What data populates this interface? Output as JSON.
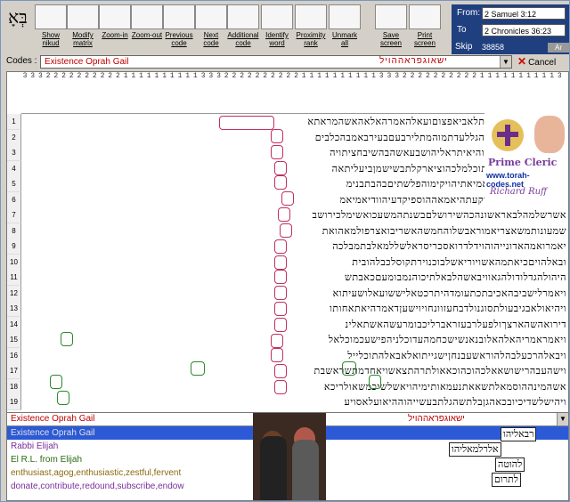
{
  "toolbar": {
    "items": [
      {
        "label": "Show\nnikud",
        "icon": "hebrew-letters-icon"
      },
      {
        "label": "Modify\nmatrix",
        "icon": "grid-icon"
      },
      {
        "label": "Zoom-in",
        "icon": "zoom-in-icon"
      },
      {
        "label": "Zoom-out",
        "icon": "zoom-out-icon"
      },
      {
        "label": "Previous\ncode",
        "icon": "arrow-left-icon"
      },
      {
        "label": "Next\ncode",
        "icon": "arrow-right-icon"
      },
      {
        "label": "Additional\ncode",
        "icon": "circles-icon"
      },
      {
        "label": "Identify\nword",
        "icon": "identify-icon"
      },
      {
        "label": "Proximity\nrank",
        "icon": "proximity-icon"
      },
      {
        "label": "Unmark\nall",
        "icon": "unmark-icon"
      },
      {
        "label": "Save\nscreen",
        "icon": "save-icon"
      },
      {
        "label": "Print\nscreen",
        "icon": "print-icon"
      }
    ],
    "logo_text": "בְּאָ"
  },
  "range": {
    "from_label": "From:",
    "from_value": "2 Samuel 3:12",
    "to_label": "To",
    "to_value": "2 Chronicles 36:23",
    "skip_label": "Skip",
    "skip_value": "38858",
    "ar_label": "Ar"
  },
  "codes": {
    "label": "Codes :",
    "value": "Existence Oprah Gail",
    "hebrew": "ישאוגפראההויל",
    "cancel_label": "Cancel"
  },
  "grid": {
    "col_digits": [
      "3",
      "3",
      "3",
      "2",
      "2",
      "2",
      "2",
      "2",
      "2",
      "2",
      "2",
      "2",
      "2",
      "1",
      "1",
      "1",
      "1",
      "1",
      "1",
      "1",
      "1",
      "1",
      "1"
    ],
    "rows": [
      "תראמרהאלידיקהראתלאביאפצוםועאלהאמרהאלאהאשהמראתא",
      "ויאמרהבכאשריבוערהגללעדתמוהמתלירבעםבעירבאמבהכלבים",
      "בתלהמאשברכתהלהוהיאיתראליהושבעאשהבהשיבחציתויה",
      "חמתינילבשלאהגראתוכלמלכהוציארקלתבשישמןביעליתאה",
      "ויבואחלעתאויומיומאמיאתיהויקימוהפלשתיםבהבתבנימ",
      "ויוגאתהבאפעיכהוקרקעתהיאמאההוספיקדעיהוודיאמיאמ",
      "אשרשלמהלבאראשונהכהשירושלםבשנתהמשעכואשימלכירושב",
      "שמעונותמשאצריאמוראבשלוהחמשהאשריבואצרפולמאהואת",
      "יאמרואמהאדונייהוהוידלדרואסכריסראלשללמאלבתמבלכה",
      "ובאלהויםכיאתמהאשויוריאשלבוכנוירתקוסלכבלהובית",
      "היהולהגדלודולהגאוויבאשהלבאלתיכוהנמבומעםכאבתש",
      "ויאמרלישביבהאכיבתכתעומדהיתרכטאליששועאלושעיתוא",
      "ויהיאולאבגיבעולתסוגנולדבחעזוונחויוישעןדאמרהיאתאחותו",
      "דירואהשהארצךולפעלרבעזראברליכבומרעשהאשתאלינ",
      "ויאמראמריהאלהאלובנאנשישכחמהעדוכלניהפישעכמוכלאל",
      "ויבאלהרכעלבהלהוראשעבנחןישגייתואלאבאלהתוכלייל",
      "וישהעבהרישושאאלכהוכהוכאאולתרהתצאשויאחדמתשראשבת",
      "אשהמינההוסמאלתשאאתנעמאותימיהויאשלשיכמשאולריכא",
      "ויהישלשדיכיובכאהגןבלתשהגלתבעשייהוההיאועלאסויע"
    ]
  },
  "logo": {
    "title": "Prime Cleric",
    "url": "www.torah-codes.net",
    "author": "Richard Ruff"
  },
  "bottom": {
    "selected_code": "Existence Oprah Gail",
    "selected_hebrew": "ישאוגפראההויל",
    "list": [
      {
        "text": "Existence Oprah Gail",
        "selected": true
      },
      {
        "text": "Rabbi Elijah",
        "selected": false
      },
      {
        "text": "El R.L. from Elijah",
        "selected": false
      },
      {
        "text": "enthusiast,agog,enthusiastic,zestful,fervent",
        "selected": false
      },
      {
        "text": "donate,contribute,redound,subscribe,endow",
        "selected": false
      }
    ],
    "hebrew_boxes": [
      "רבאליהו",
      "אלרלמאליהו",
      "להוטה",
      "לתרום"
    ]
  },
  "colors": {
    "highlight_red": "#c03060",
    "highlight_green": "#2a8a2a",
    "selection_blue": "#2c5ad6",
    "code_red": "#c00000"
  }
}
